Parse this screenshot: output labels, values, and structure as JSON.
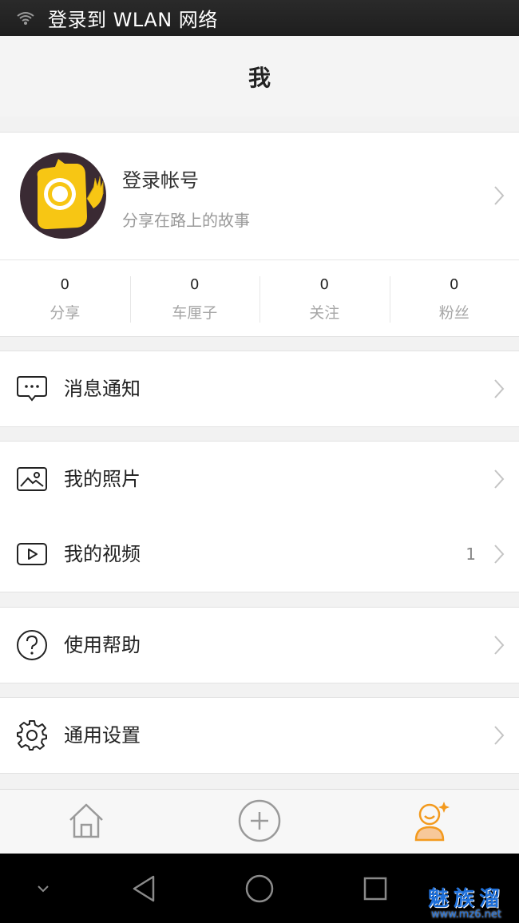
{
  "status_bar": {
    "text": "登录到 WLAN 网络",
    "icon": "wifi-question-icon"
  },
  "header": {
    "title": "我"
  },
  "profile": {
    "name": "登录帐号",
    "motto": "分享在路上的故事",
    "avatar_icon": "camera-mascot-avatar"
  },
  "stats": [
    {
      "value": "0",
      "label": "分享"
    },
    {
      "value": "0",
      "label": "车厘子"
    },
    {
      "value": "0",
      "label": "关注"
    },
    {
      "value": "0",
      "label": "粉丝"
    }
  ],
  "menu": {
    "messages": {
      "label": "消息通知",
      "icon": "message-icon"
    },
    "photos": {
      "label": "我的照片",
      "icon": "photo-icon"
    },
    "videos": {
      "label": "我的视频",
      "icon": "video-icon",
      "count": "1"
    },
    "help": {
      "label": "使用帮助",
      "icon": "help-icon"
    },
    "settings": {
      "label": "通用设置",
      "icon": "gear-icon"
    }
  },
  "tabbar": {
    "items": [
      {
        "icon": "home-icon",
        "active": false
      },
      {
        "icon": "add-icon",
        "active": false
      },
      {
        "icon": "profile-icon",
        "active": true
      }
    ]
  },
  "navbar": {
    "items": [
      "collapse-icon",
      "back-icon",
      "home-circle-icon",
      "recents-icon"
    ]
  },
  "watermark": {
    "big": "魅族溜",
    "small": "www.mz6.net"
  },
  "colors": {
    "accent": "#f39a1e",
    "avatar_yellow": "#f7c614",
    "avatar_bg": "#3a2a33"
  }
}
